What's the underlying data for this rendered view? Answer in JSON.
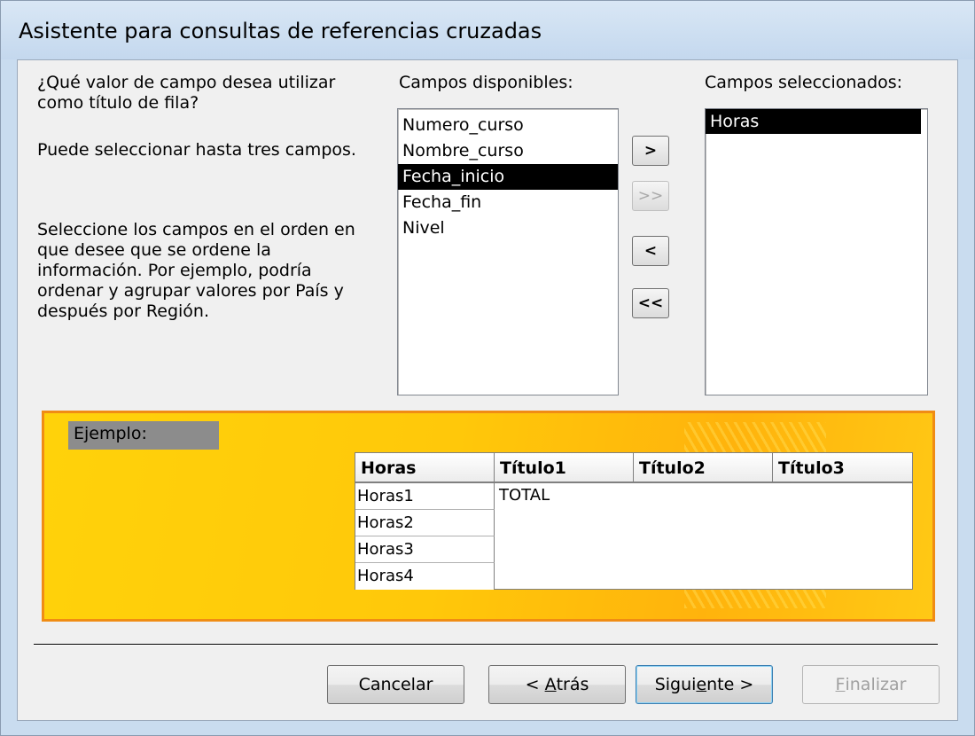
{
  "window": {
    "title": "Asistente para consultas de referencias cruzadas"
  },
  "instructions": {
    "question": "¿Qué valor de campo desea utilizar como título de fila?",
    "limit": "Puede seleccionar hasta tres campos.",
    "order_help": "Seleccione los campos en el orden en que desee que se ordene la información. Por ejemplo, podría ordenar y agrupar valores por País y después por Región."
  },
  "available": {
    "label": "Campos disponibles:",
    "items": [
      "Numero_curso",
      "Nombre_curso",
      "Fecha_inicio",
      "Fecha_fin",
      "Nivel"
    ],
    "selected": "Fecha_inicio"
  },
  "selected_fields": {
    "label": "Campos seleccionados:",
    "items": [
      "Horas"
    ]
  },
  "transfer_buttons": {
    "add": ">",
    "add_all": ">>",
    "remove": "<",
    "remove_all": "<<"
  },
  "example": {
    "label": "Ejemplo:",
    "headers": [
      "Horas",
      "Título1",
      "Título2",
      "Título3"
    ],
    "rows": [
      "Horas1",
      "Horas2",
      "Horas3",
      "Horas4"
    ],
    "total": "TOTAL"
  },
  "footer": {
    "cancel": "Cancelar",
    "back_prefix": "< ",
    "back_mnemonic": "A",
    "back_rest": "trás",
    "next_prefix": "Sigui",
    "next_mnemonic": "e",
    "next_rest": "nte >",
    "finish_mnemonic": "F",
    "finish_rest": "inalizar"
  }
}
